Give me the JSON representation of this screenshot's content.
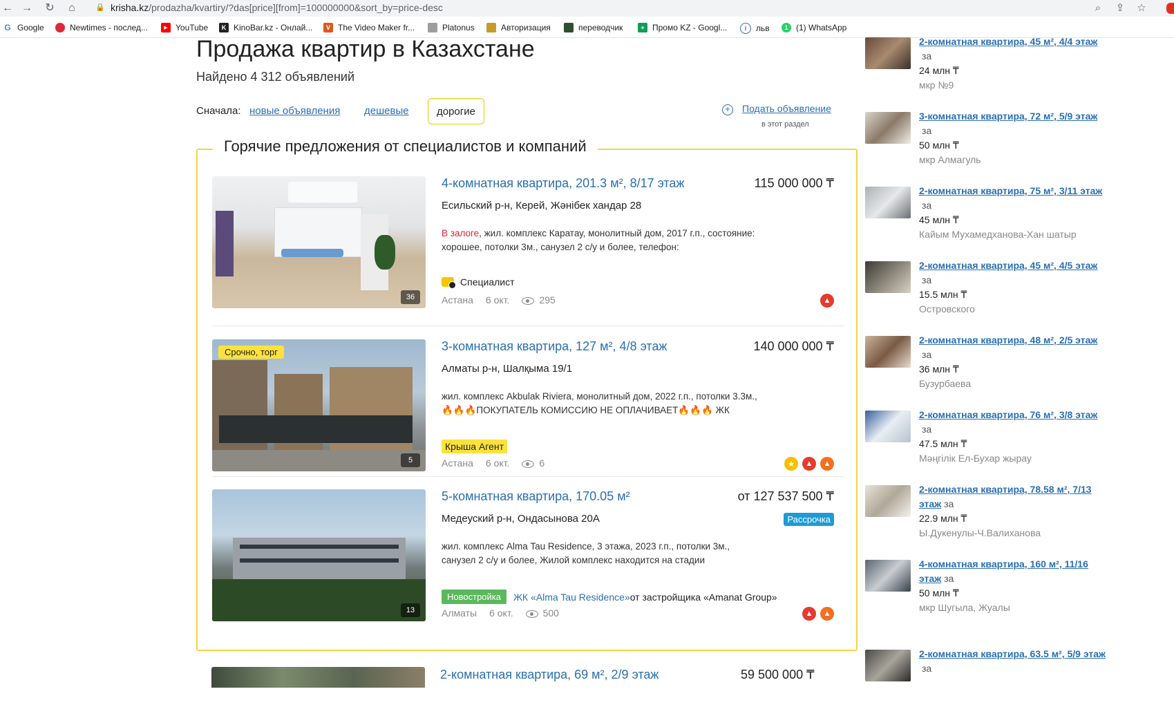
{
  "browser": {
    "url_host": "krisha.kz",
    "url_path": "/prodazha/kvartiry/?das[price][from]=100000000&sort_by=price-desc",
    "bookmarks": [
      {
        "label": "Google",
        "icon": "google-icon",
        "color": "#4285f4"
      },
      {
        "label": "Newtimes - послед...",
        "icon": "newtimes-icon",
        "color": "#e0283c"
      },
      {
        "label": "YouTube",
        "icon": "youtube-icon",
        "color": "#ff0000"
      },
      {
        "label": "KinoBar.kz - Онлай...",
        "icon": "kinobar-icon",
        "color": "#222222"
      },
      {
        "label": "The Video Maker fr...",
        "icon": "videomaker-icon",
        "color": "#d9591a"
      },
      {
        "label": "Platonus",
        "icon": "platonus-icon",
        "color": "#9e9e9e"
      },
      {
        "label": "Авторизация",
        "icon": "auth-icon",
        "color": "#c79a2a"
      },
      {
        "label": "переводчик",
        "icon": "translator-icon",
        "color": "#2f4f2f"
      },
      {
        "label": "Промо KZ - Googl...",
        "icon": "sheets-icon",
        "color": "#0f9d58"
      },
      {
        "label": "льв",
        "icon": "lv-icon",
        "color": "#3a6ab0"
      },
      {
        "label": "(1) WhatsApp",
        "icon": "whatsapp-icon",
        "color": "#25d366"
      }
    ]
  },
  "page": {
    "title": "Продажа квартир в Казахстане",
    "found": "Найдено 4 312 объявлений",
    "sort": {
      "label": "Сначала:",
      "new": "новые объявления",
      "cheap": "дешевые",
      "expensive": "дорогие"
    },
    "post_ad": {
      "label": "Подать объявление",
      "sub": "в этот раздел"
    },
    "hot_title": "Горячие предложения от специалистов и компаний"
  },
  "listings": [
    {
      "title": "4-комнатная квартира, 201.3 м², 8/17 этаж",
      "price": "115 000 000 ₸",
      "address": "Есильский р-н, Керей, Жәнібек хандар 28",
      "desc_red": "В залоге",
      "desc": ", жил. комплекс Каратау, монолитный дом, 2017 г.п., состояние: хорошее, потолки 3м., санузел 2 с/у и более, телефон:",
      "agent": "Специалист",
      "city": "Астана",
      "date": "6 окт.",
      "views": "295",
      "photos": "36"
    },
    {
      "title": "3-комнатная квартира, 127 м², 4/8 этаж",
      "price": "140 000 000 ₸",
      "address": "Алматы р-н, Шалқыма 19/1",
      "desc": "жил. комплекс Akbulak Riviera, монолитный дом, 2022 г.п., потолки 3.3м.,🔥🔥🔥ПОКУПАТЕЛЬ КОМИССИЮ НЕ ОПЛАЧИВАЕТ🔥🔥🔥 ЖК",
      "tag": "Срочно, торг",
      "agent": "Крыша Агент",
      "city": "Астана",
      "date": "6 окт.",
      "views": "6",
      "photos": "5"
    },
    {
      "title": "5-комнатная квартира, 170.05 м²",
      "price": "от 127 537 500 ₸",
      "address": "Медеуский р-н, Ондасынова 20А",
      "badge": "Рассрочка",
      "desc": "жил. комплекс Alma Tau Residence, 3 этажа, 2023 г.п., потолки 3м., санузел 2 с/у и более, Жилой комплекс находится на стадии",
      "new_build": "Новостройка",
      "jk_link": "ЖК «Alma Tau Residence»",
      "developer": " от застройщика «Amanat Group»",
      "city": "Алматы",
      "date": "6 окт.",
      "views": "500",
      "photos": "13"
    },
    {
      "title": "2-комнатная квартира, 69 м², 2/9 этаж",
      "price": "59 500 000 ₸"
    }
  ],
  "sidebar": [
    {
      "title": "2-комнатная квартира, 45 м², 4/4 этаж",
      "za": "за",
      "price": "24 млн ₸",
      "loc": "мкр №9"
    },
    {
      "title": "3-комнатная квартира, 72 м², 5/9 этаж",
      "za": "за",
      "price": "50 млн ₸",
      "loc": "мкр Алмагуль"
    },
    {
      "title": "2-комнатная квартира, 75 м², 3/11 этаж",
      "za": "за",
      "price": "45 млн ₸",
      "loc": "Кайым Мухамедханова-Хан шатыр"
    },
    {
      "title": "2-комнатная квартира, 45 м², 4/5 этаж",
      "za": "за",
      "price": "15.5 млн ₸",
      "loc": "Островского"
    },
    {
      "title": "2-комнатная квартира, 48 м², 2/5 этаж",
      "za": "за",
      "price": "36 млн ₸",
      "loc": "Бузурбаева"
    },
    {
      "title": "2-комнатная квартира, 76 м², 3/8 этаж",
      "za": "за",
      "price": "47.5 млн ₸",
      "loc": "Мәңгілік Ел-Бухар жырау"
    },
    {
      "title": "2-комнатная квартира, 78.58 м², 7/13 этаж",
      "za": "за",
      "price": "22.9 млн ₸",
      "loc": "Ы.Дукенулы-Ч.Валиханова"
    },
    {
      "title": "4-комнатная квартира, 160 м², 11/16 этаж",
      "za": "за",
      "price": "50 млн ₸",
      "loc": "мкр Шугыла, Жуалы"
    },
    {
      "title": "2-комнатная квартира, 63.5 м², 5/9 этаж",
      "za": "за"
    }
  ]
}
